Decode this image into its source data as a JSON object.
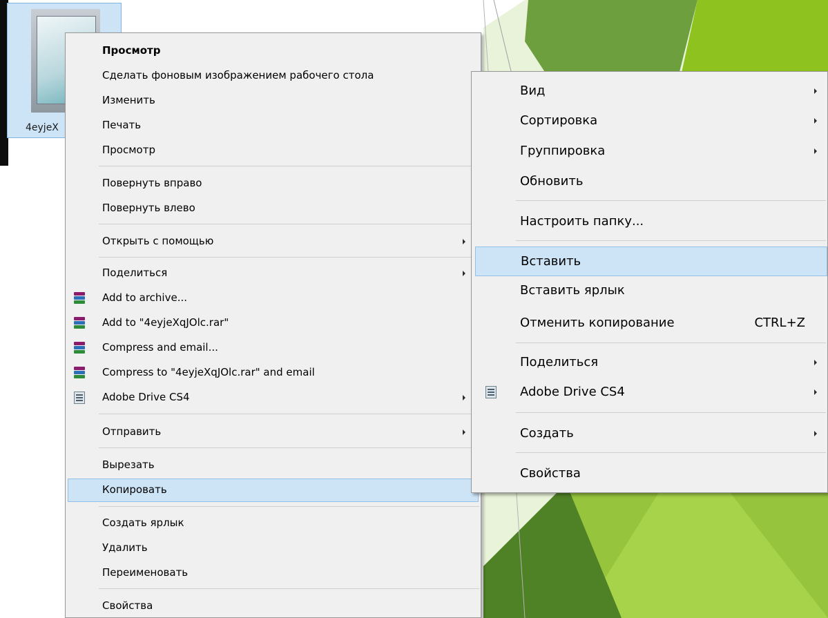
{
  "file": {
    "name": "4eyjeX"
  },
  "left_menu": {
    "items": [
      {
        "label": "Просмотр"
      },
      {
        "label": "Сделать фоновым изображением рабочего стола"
      },
      {
        "label": "Изменить"
      },
      {
        "label": "Печать"
      },
      {
        "label": "Просмотр"
      },
      {
        "label": "Повернуть вправо"
      },
      {
        "label": "Повернуть влево"
      },
      {
        "label": "Открыть с помощью"
      },
      {
        "label": "Поделиться"
      },
      {
        "label": "Add to archive..."
      },
      {
        "label": "Add to \"4eyjeXqJOlc.rar\""
      },
      {
        "label": "Compress and email..."
      },
      {
        "label": "Compress to \"4eyjeXqJOlc.rar\" and email"
      },
      {
        "label": "Adobe Drive CS4"
      },
      {
        "label": "Отправить"
      },
      {
        "label": "Вырезать"
      },
      {
        "label": "Копировать"
      },
      {
        "label": "Создать ярлык"
      },
      {
        "label": "Удалить"
      },
      {
        "label": "Переименовать"
      },
      {
        "label": "Свойства"
      }
    ]
  },
  "right_menu": {
    "items": [
      {
        "label": "Вид"
      },
      {
        "label": "Сортировка"
      },
      {
        "label": "Группировка"
      },
      {
        "label": "Обновить"
      },
      {
        "label": "Настроить папку..."
      },
      {
        "label": "Вставить"
      },
      {
        "label": "Вставить ярлык"
      },
      {
        "label": "Отменить копирование",
        "shortcut": "CTRL+Z"
      },
      {
        "label": "Поделиться"
      },
      {
        "label": "Adobe Drive CS4"
      },
      {
        "label": "Создать"
      },
      {
        "label": "Свойства"
      }
    ]
  },
  "colors": {
    "highlight": "#cde4f7",
    "menu_bg": "#f0f0f0",
    "accent_green": "#8dc21f"
  },
  "icons": [
    "winrar-icon",
    "adobe-drive-icon",
    "submenu-arrow-icon"
  ]
}
